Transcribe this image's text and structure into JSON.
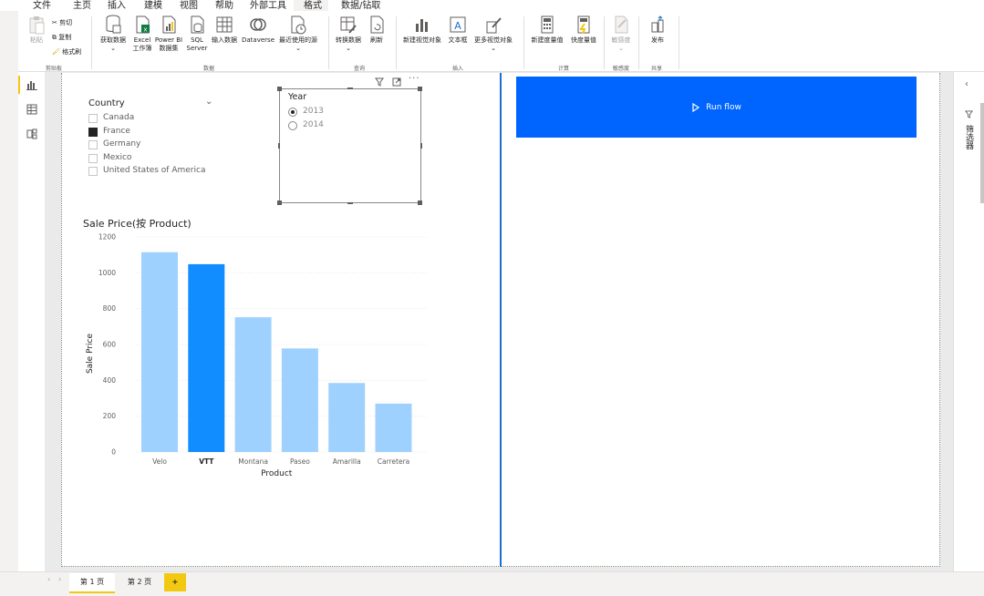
{
  "menu": {
    "tabs": [
      "文件",
      "主页",
      "插入",
      "建模",
      "视图",
      "帮助",
      "外部工具",
      "格式",
      "数据/钻取"
    ],
    "active": "主页"
  },
  "ribbon": {
    "clipboard": {
      "paste": "粘贴",
      "cut": "剪切",
      "copy": "复制",
      "format_painter": "格式刷",
      "group": "剪贴板"
    },
    "data": {
      "get_data": "获取数据",
      "excel_line1": "Excel",
      "excel_line2": "工作簿",
      "powerbi_line1": "Power BI",
      "powerbi_line2": "数据集",
      "sql_line1": "SQL",
      "sql_line2": "Server",
      "enter_data": "输入数据",
      "dataverse": "Dataverse",
      "recent_sources": "最近使用的源",
      "group": "数据"
    },
    "query": {
      "transform": "转换数据",
      "refresh": "刷新",
      "group": "查询"
    },
    "insert": {
      "new_visual": "新建视觉对象",
      "text_box": "文本框",
      "more_visuals": "更多视觉对象",
      "group": "插入"
    },
    "calculations": {
      "new_measure": "新建度量值",
      "quick_measure": "快度量值",
      "group": "计算"
    },
    "sensitivity": {
      "label": "敏感度",
      "group": "敏感度"
    },
    "share": {
      "publish": "发布",
      "group": "共享"
    }
  },
  "country_slicer": {
    "title": "Country",
    "items": [
      {
        "label": "Canada",
        "checked": false
      },
      {
        "label": "France",
        "checked": true
      },
      {
        "label": "Germany",
        "checked": false
      },
      {
        "label": "Mexico",
        "checked": false
      },
      {
        "label": "United States of America",
        "checked": false
      }
    ]
  },
  "year_slicer": {
    "title": "Year",
    "options": [
      {
        "label": "2013",
        "selected": true
      },
      {
        "label": "2014",
        "selected": false
      }
    ]
  },
  "chart_data": {
    "type": "bar",
    "title": "Sale Price(按 Product)",
    "xlabel": "Product",
    "ylabel": "Sale Price",
    "categories": [
      "Velo",
      "VTT",
      "Montana",
      "Paseo",
      "Amarilla",
      "Carretera"
    ],
    "values": [
      1115,
      1048,
      752,
      578,
      385,
      270
    ],
    "highlighted": "VTT",
    "ylim": [
      0,
      1200
    ],
    "yticks": [
      0,
      200,
      400,
      600,
      800,
      1000,
      1200
    ],
    "colors": {
      "bar": "#9fd1ff",
      "highlight": "#118dff"
    },
    "grid": true
  },
  "run_flow": {
    "label": "Run flow",
    "color": "#0065ff"
  },
  "right_pane": {
    "filters_label": "筛选器"
  },
  "pages": {
    "tabs": [
      "第 1 页",
      "第 2 页"
    ],
    "active": "第 1 页",
    "add": "+"
  }
}
